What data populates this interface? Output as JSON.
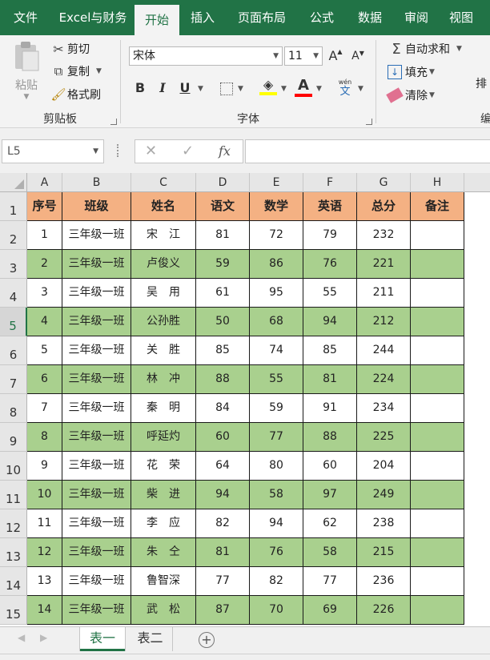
{
  "ribbon_tabs": [
    "文件",
    "Excel与财务",
    "开始",
    "插入",
    "页面布局",
    "公式",
    "数据",
    "审阅",
    "视图"
  ],
  "active_tab_index": 2,
  "colors": {
    "brand": "#217346",
    "header_fill": "#f4b183",
    "band_fill": "#a9d08e"
  },
  "clipboard": {
    "paste": "粘贴",
    "cut": "剪切",
    "copy": "复制",
    "format_painter": "格式刷",
    "group": "剪贴板"
  },
  "font": {
    "name": "宋体",
    "size": "11",
    "group": "字体",
    "bold": "B",
    "italic": "I",
    "underline": "U",
    "grow": "A",
    "shrink": "A",
    "phonetic_top": "wén",
    "phonetic_bottom": "文"
  },
  "editing": {
    "autosum": "自动求和",
    "fill": "填充",
    "clear": "清除",
    "sort_partial": "排",
    "group_partial": "编"
  },
  "formula_bar": {
    "name_box": "L5",
    "cancel": "✕",
    "enter": "✓",
    "fx": "fx",
    "content": ""
  },
  "columns": [
    "A",
    "B",
    "C",
    "D",
    "E",
    "F",
    "G",
    "H"
  ],
  "row_numbers": [
    "1",
    "2",
    "3",
    "4",
    "5",
    "6",
    "7",
    "8",
    "9",
    "10",
    "11",
    "12",
    "13",
    "14",
    "15"
  ],
  "selected_row": "5",
  "table": {
    "headers": [
      "序号",
      "班级",
      "姓名",
      "语文",
      "数学",
      "英语",
      "总分",
      "备注"
    ],
    "rows": [
      [
        "1",
        "三年级一班",
        "宋　江",
        "81",
        "72",
        "79",
        "232",
        ""
      ],
      [
        "2",
        "三年级一班",
        "卢俊义",
        "59",
        "86",
        "76",
        "221",
        ""
      ],
      [
        "3",
        "三年级一班",
        "吴　用",
        "61",
        "95",
        "55",
        "211",
        ""
      ],
      [
        "4",
        "三年级一班",
        "公孙胜",
        "50",
        "68",
        "94",
        "212",
        ""
      ],
      [
        "5",
        "三年级一班",
        "关　胜",
        "85",
        "74",
        "85",
        "244",
        ""
      ],
      [
        "6",
        "三年级一班",
        "林　冲",
        "88",
        "55",
        "81",
        "224",
        ""
      ],
      [
        "7",
        "三年级一班",
        "秦　明",
        "84",
        "59",
        "91",
        "234",
        ""
      ],
      [
        "8",
        "三年级一班",
        "呼延灼",
        "60",
        "77",
        "88",
        "225",
        ""
      ],
      [
        "9",
        "三年级一班",
        "花　荣",
        "64",
        "80",
        "60",
        "204",
        ""
      ],
      [
        "10",
        "三年级一班",
        "柴　进",
        "94",
        "58",
        "97",
        "249",
        ""
      ],
      [
        "11",
        "三年级一班",
        "李　应",
        "82",
        "94",
        "62",
        "238",
        ""
      ],
      [
        "12",
        "三年级一班",
        "朱　仝",
        "81",
        "76",
        "58",
        "215",
        ""
      ],
      [
        "13",
        "三年级一班",
        "鲁智深",
        "77",
        "82",
        "77",
        "236",
        ""
      ],
      [
        "14",
        "三年级一班",
        "武　松",
        "87",
        "70",
        "69",
        "226",
        ""
      ]
    ]
  },
  "sheets": [
    "表一",
    "表二"
  ],
  "active_sheet": 0
}
